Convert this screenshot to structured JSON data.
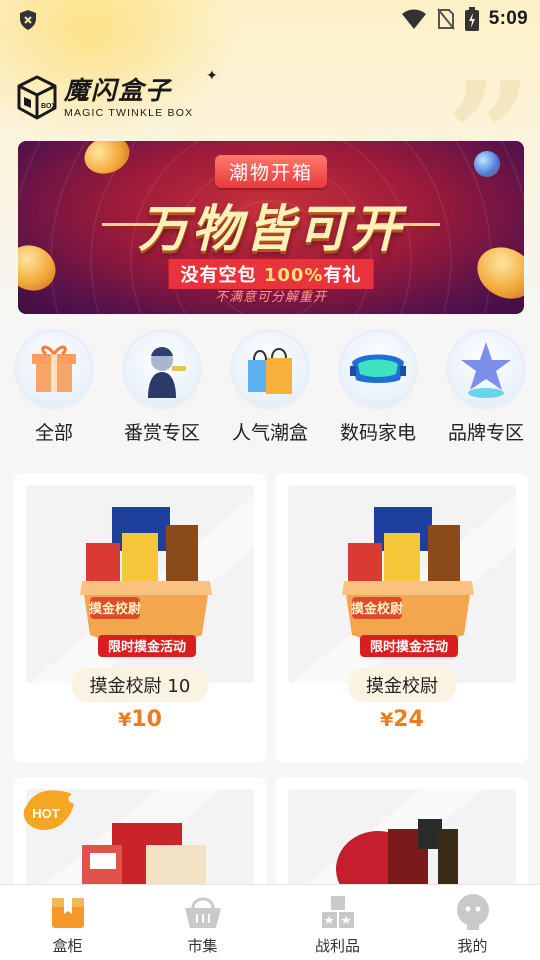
{
  "status_bar": {
    "time": "5:09"
  },
  "logo": {
    "cn": "魔闪盒子",
    "en": "MAGIC TWINKLE BOX"
  },
  "banner": {
    "tag": "潮物开箱",
    "title": "万物皆可开",
    "sub_prefix": "没有空包 ",
    "sub_highlight": "100%",
    "sub_suffix": "有礼",
    "note": "不满意可分解重开"
  },
  "categories": [
    {
      "label": "全部",
      "icon": "gift-box-icon"
    },
    {
      "label": "番赏专区",
      "icon": "figure-icon"
    },
    {
      "label": "人气潮盒",
      "icon": "shopping-bag-icon"
    },
    {
      "label": "数码家电",
      "icon": "vr-headset-icon"
    },
    {
      "label": "品牌专区",
      "icon": "star-trophy-icon"
    }
  ],
  "products": [
    {
      "name": "摸金校尉 10",
      "currency": "¥",
      "price": "10",
      "badge_top": "摸金校尉",
      "badge_bottom": "限时摸金活动"
    },
    {
      "name": "摸金校尉",
      "currency": "¥",
      "price": "24",
      "badge_top": "摸金校尉",
      "badge_bottom": "限时摸金活动"
    },
    {
      "name": "",
      "hot": "HOT"
    },
    {
      "name": ""
    }
  ],
  "bottom_nav": [
    {
      "label": "盒柜",
      "icon": "box-cabinet-icon",
      "active": true
    },
    {
      "label": "市集",
      "icon": "basket-icon",
      "active": false
    },
    {
      "label": "战利品",
      "icon": "trophy-boxes-icon",
      "active": false
    },
    {
      "label": "我的",
      "icon": "profile-icon",
      "active": false
    }
  ],
  "colors": {
    "accent": "#f07b1a",
    "nav_active": "#f39a2a",
    "nav_inactive": "#c9c9c9"
  }
}
